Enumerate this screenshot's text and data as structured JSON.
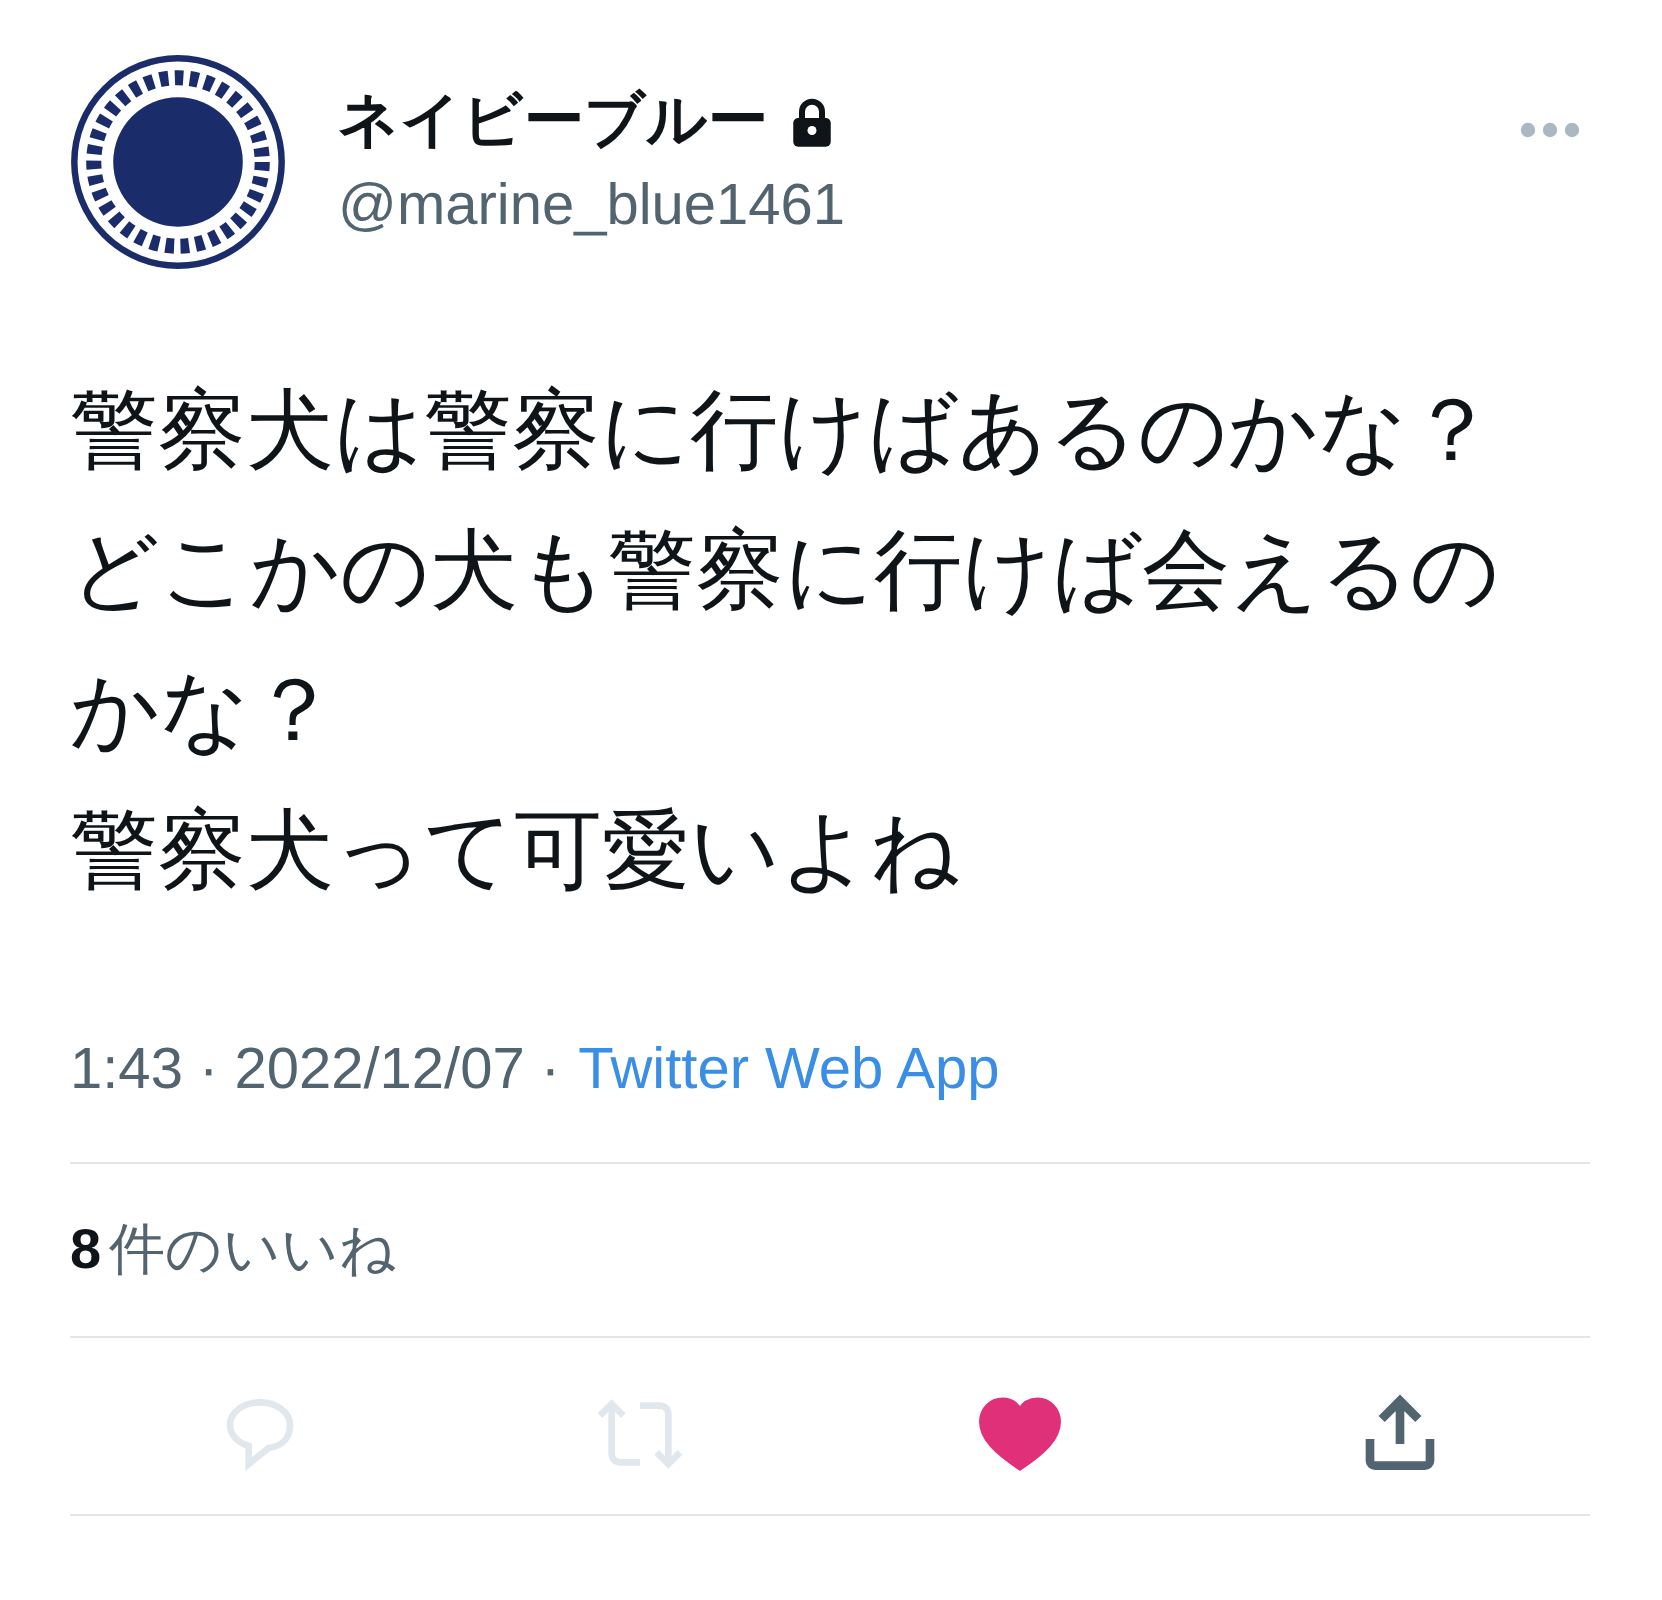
{
  "author": {
    "name": "ネイビーブルー",
    "protected": true,
    "handle": "@marine_blue1461"
  },
  "tweet": {
    "paragraphs": [
      "警察犬は警察に行けばあるのかな？どこかの犬も警察に行けば会えるのかな？",
      "警察犬って可愛いよね"
    ]
  },
  "meta": {
    "timestamp": "1:43 · 2022/12/07 ·",
    "source": "Twitter Web App"
  },
  "likes": {
    "text": "**8**件のいいね"
  },
  "actions": [
    {
      "kind": "reply",
      "disabled": true,
      "active": false
    },
    {
      "kind": "retweet",
      "disabled": true,
      "active": false
    },
    {
      "kind": "like",
      "disabled": false,
      "active": true
    },
    {
      "kind": "share",
      "disabled": false,
      "active": false
    }
  ]
}
